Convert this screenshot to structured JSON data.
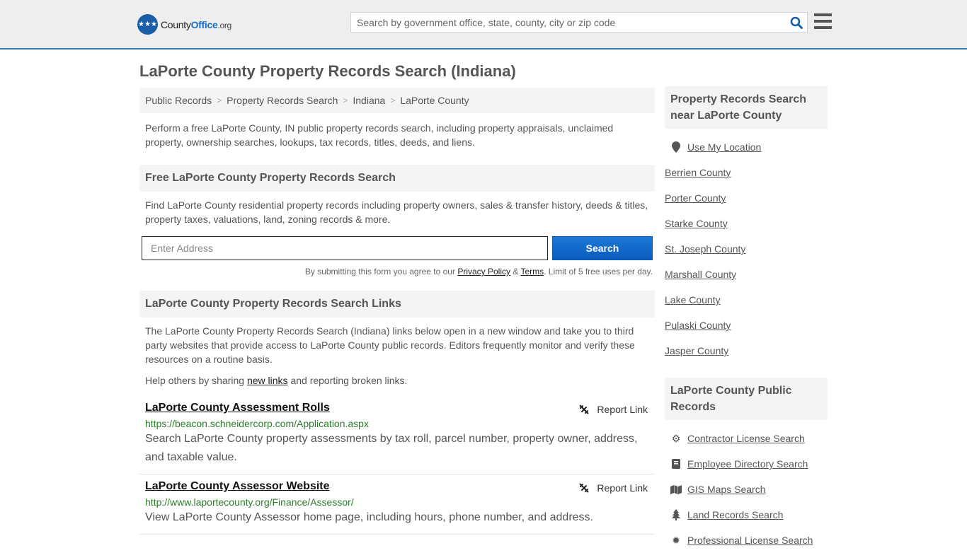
{
  "header": {
    "logo_main": "County",
    "logo_accent": "Office",
    "logo_suffix": ".org",
    "search_placeholder": "Search by government office, state, county, city or zip code"
  },
  "page": {
    "title": "LaPorte County Property Records Search (Indiana)"
  },
  "breadcrumb": [
    "Public Records",
    "Property Records Search",
    "Indiana",
    "LaPorte County"
  ],
  "intro": "Perform a free LaPorte County, IN public property records search, including property appraisals, unclaimed property, ownership searches, lookups, tax records, titles, deeds, and liens.",
  "free_search": {
    "heading": "Free LaPorte County Property Records Search",
    "description": "Find LaPorte County residential property records including property owners, sales & transfer history, deeds & titles, property taxes, valuations, land, zoning records & more.",
    "input_placeholder": "Enter Address",
    "button_label": "Search",
    "agree_prefix": "By submitting this form you agree to our ",
    "privacy_label": "Privacy Policy",
    "amp": " & ",
    "terms_label": "Terms",
    "agree_suffix": ". Limit of 5 free uses per day."
  },
  "links_section": {
    "heading": "LaPorte County Property Records Search Links",
    "description": "The LaPorte County Property Records Search (Indiana) links below open in a new window and take you to third party websites that provide access to LaPorte County public records. Editors frequently monitor and verify these resources on a routine basis.",
    "help_prefix": "Help others by sharing ",
    "help_link": "new links",
    "help_suffix": " and reporting broken links.",
    "report_label": "Report Link",
    "results": [
      {
        "title": "LaPorte County Assessment Rolls",
        "url": "https://beacon.schneidercorp.com/Application.aspx",
        "description": "Search LaPorte County property assessments by tax roll, parcel number, property owner, address, and taxable value."
      },
      {
        "title": "LaPorte County Assessor Website",
        "url": "http://www.laportecounty.org/Finance/Assessor/",
        "description": "View LaPorte County Assessor home page, including hours, phone number, and address."
      }
    ]
  },
  "sidebar": {
    "nearby_heading": "Property Records Search near LaPorte County",
    "use_location": "Use My Location",
    "nearby": [
      "Berrien County",
      "Porter County",
      "Starke County",
      "St. Joseph County",
      "Marshall County",
      "Lake County",
      "Pulaski County",
      "Jasper County"
    ],
    "public_heading": "LaPorte County Public Records",
    "public_links": [
      {
        "label": "Contractor License Search",
        "icon": "gear-icon"
      },
      {
        "label": "Employee Directory Search",
        "icon": "book-icon"
      },
      {
        "label": "GIS Maps Search",
        "icon": "map-icon"
      },
      {
        "label": "Land Records Search",
        "icon": "tree-icon"
      },
      {
        "label": "Professional License Search",
        "icon": "certificate-icon"
      }
    ]
  }
}
